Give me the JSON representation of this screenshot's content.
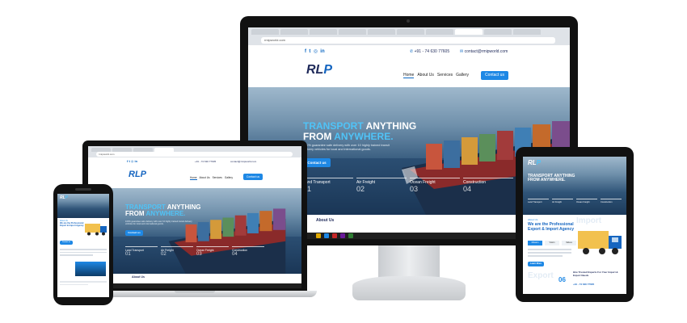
{
  "desktop": {
    "browser_tabs": [
      "Magazines",
      "Website Re",
      "Web Makeo",
      "Free PVS",
      "Wheat Ano",
      "Mark Innov",
      "Best app",
      "Home - RMI",
      "Mov Bler",
      "Lithuanian Ro"
    ],
    "url": "rmipworld.com",
    "header": {
      "social_icons": [
        "f",
        "t",
        "ig",
        "in"
      ],
      "phone": "+91 - 74 630 77605",
      "email": "contact@rmipworld.com",
      "logo_main": "RL",
      "logo_accent": "P",
      "nav": [
        "Home",
        "About Us",
        "Services",
        "Gallery"
      ],
      "cta": "Contact us"
    },
    "hero": {
      "title_1_hl": "TRANSPORT",
      "title_1": "ANYTHING",
      "title_2": "FROM",
      "title_2_hl": "ANYWHERE.",
      "subtitle": "100% guarantee safe delivery with over 10 highly trained transit delivery vehicles for local and international goods.",
      "button": "Contact us",
      "features": [
        {
          "label": "Land Transport",
          "num": "01"
        },
        {
          "label": "Air Freight",
          "num": "02"
        },
        {
          "label": "Ocean Freight",
          "num": "03"
        },
        {
          "label": "Construction",
          "num": "04"
        }
      ]
    },
    "about": "About Us"
  },
  "laptop": {
    "url": "rmipworld.com",
    "phone": "+91 - 74 630 77605",
    "email": "contact@rmipworld.com",
    "nav": [
      "Home",
      "About Us",
      "Services",
      "Gallery"
    ],
    "cta": "Contact us",
    "hero_title_1_hl": "TRANSPORT",
    "hero_title_1": "ANYTHING",
    "hero_title_2": "FROM",
    "hero_title_2_hl": "ANYWHERE.",
    "hero_sub": "100% guarantee safe delivery with over 10 highly trained transit delivery vehicles for local and international goods.",
    "button": "Contact us",
    "features": [
      {
        "label": "Land Transport",
        "num": "01"
      },
      {
        "label": "Air Freight",
        "num": "02"
      },
      {
        "label": "Ocean Freight",
        "num": "03"
      },
      {
        "label": "Construction",
        "num": "04"
      }
    ],
    "about": "About Us"
  },
  "tablet": {
    "hero_title_1": "TRANSPORT ANYTHING",
    "hero_title_2": "FROM ANYWHERE.",
    "features": [
      "Land Transport",
      "Air Freight",
      "Ocean Freight",
      "Construction"
    ],
    "about_label": "About Us",
    "about_title": "We are the Professional Export & Import Agency",
    "tabs": [
      "Mission",
      "Vision",
      "Values"
    ],
    "import_word": "Import",
    "export_word": "Export",
    "badge_num": "06",
    "cta_button": "Learn More",
    "contact_text": "Hire Trusted Experts For Your Import & Export Needs",
    "contact_phone": "+91 - 74 630 77605"
  },
  "phone": {
    "about_label": "About Us",
    "about_title": "We are the Professional Export & Import Agency",
    "button": "Contact us"
  },
  "colors": {
    "brand_blue": "#1e88e5",
    "navy": "#1f2a5a",
    "device_black": "#111111",
    "stand_silver": "#d6d8db"
  }
}
